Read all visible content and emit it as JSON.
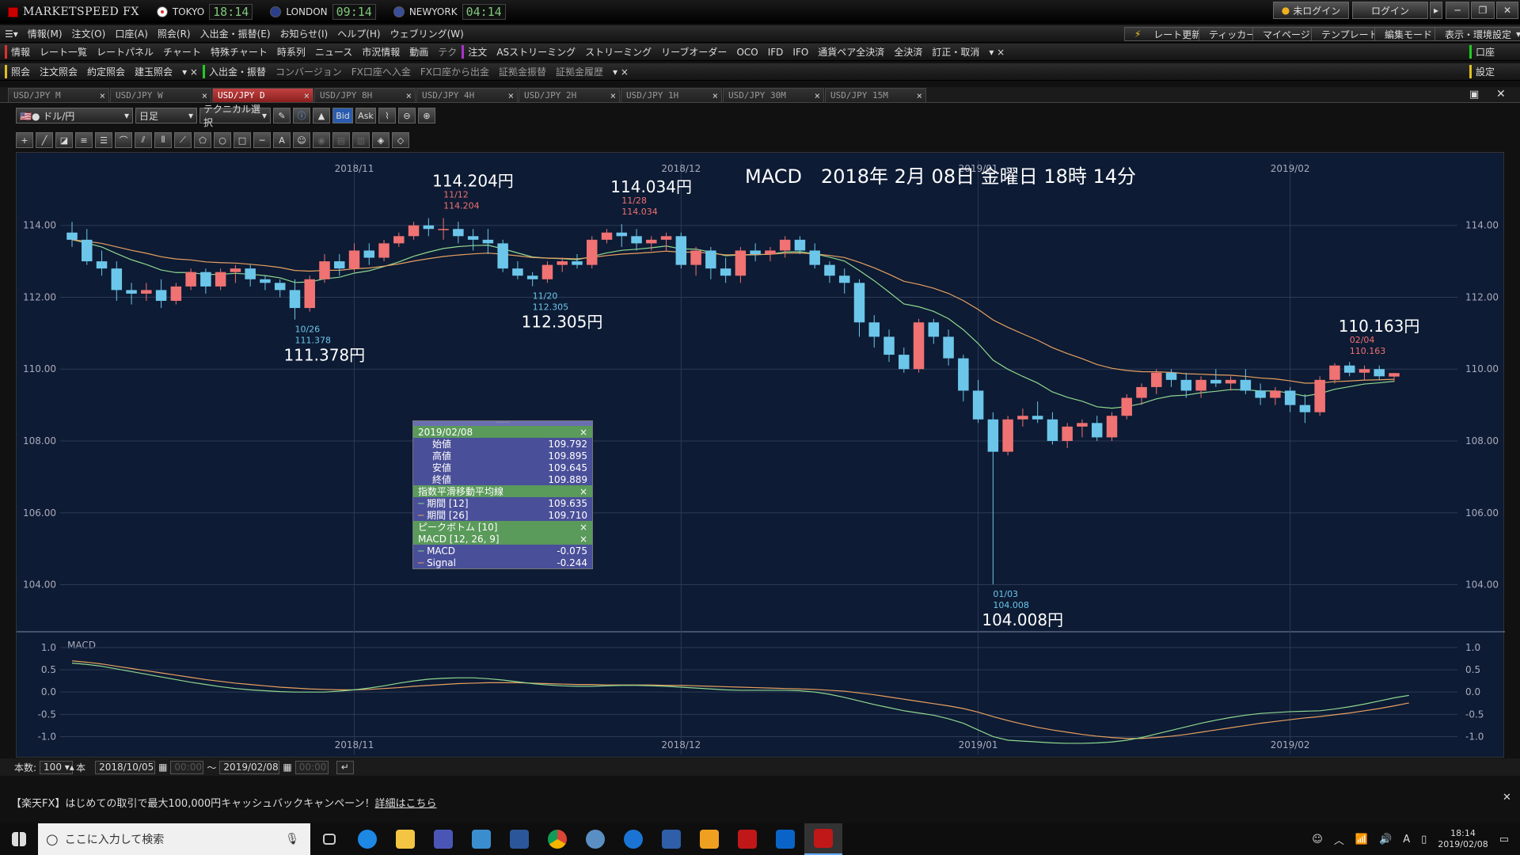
{
  "app": {
    "name": "MARKETSPEED FX",
    "clocks": [
      {
        "label": "TOKYO",
        "time": "18:14",
        "color": "#e03030"
      },
      {
        "label": "LONDON",
        "time": "09:14",
        "color": "#3050c0"
      },
      {
        "label": "NEWYORK",
        "time": "04:14",
        "color": "#3050c0"
      }
    ],
    "login_status": "未ログイン",
    "login_button": "ログイン"
  },
  "menu": {
    "items": [
      "情報(M)",
      "注文(O)",
      "口座(A)",
      "照会(R)",
      "入出金・振替(E)",
      "お知らせ(I)",
      "ヘルプ(H)",
      "ウェブリング(W)"
    ],
    "right": [
      "レート更新",
      "ティッカー",
      "マイページ",
      "テンプレート",
      "編集モード",
      "表示・環境設定"
    ]
  },
  "toolbar1": {
    "group1": "情報",
    "items1": [
      "レート一覧",
      "レートパネル",
      "チャート",
      "特殊チャート",
      "時系列",
      "ニュース",
      "市況情報",
      "動画",
      "テク"
    ],
    "group2": "注文",
    "items2": [
      "ASストリーミング",
      "ストリーミング",
      "リーブオーダー",
      "OCO",
      "IFD",
      "IFO",
      "通貨ペア全決済",
      "全決済",
      "訂正・取消"
    ],
    "right": "口座"
  },
  "toolbar2": {
    "group1": "照会",
    "items1": [
      "注文照会",
      "約定照会",
      "建玉照会"
    ],
    "group2": "入出金・振替",
    "items2": [
      "コンバージョン",
      "FX口座へ入金",
      "FX口座から出金",
      "証拠金振替",
      "証拠金履歴"
    ],
    "right": "設定"
  },
  "tabs": [
    "USD/JPY M",
    "USD/JPY W",
    "USD/JPY D",
    "USD/JPY 8H",
    "USD/JPY 4H",
    "USD/JPY 2H",
    "USD/JPY 1H",
    "USD/JPY 30M",
    "USD/JPY 15M"
  ],
  "active_tab": 2,
  "chart_toolbar": {
    "pair": "ドル/円",
    "period": "日足",
    "technical": "テクニカル選択",
    "bid": "Bid",
    "ask": "Ask"
  },
  "chart_title": "MACD　2018年 2月 08日 金曜日 18時 14分",
  "price_labels": [
    {
      "date": "10/26",
      "price": "111.378",
      "big": "111.378円",
      "type": "low"
    },
    {
      "date": "11/12",
      "price": "114.204",
      "big": "114.204円",
      "type": "high"
    },
    {
      "date": "11/20",
      "price": "112.305",
      "big": "112.305円",
      "type": "low"
    },
    {
      "date": "11/28",
      "price": "114.034",
      "big": "114.034円",
      "type": "high"
    },
    {
      "date": "01/03",
      "price": "104.008",
      "big": "104.008円",
      "type": "low"
    },
    {
      "date": "02/04",
      "price": "110.163",
      "big": "110.163円",
      "type": "high"
    }
  ],
  "chart_data": {
    "type": "candlestick",
    "x_ticks": [
      "2018/11",
      "2018/12",
      "2019/01",
      "2019/02"
    ],
    "y_ticks": [
      "114.00",
      "112.00",
      "110.00",
      "108.00",
      "106.00",
      "104.00"
    ],
    "ylim": [
      102.8,
      115.8
    ],
    "candles": [
      [
        113.8,
        114.1,
        113.4,
        113.6
      ],
      [
        113.6,
        113.9,
        112.9,
        113.0
      ],
      [
        113.0,
        113.3,
        112.6,
        112.8
      ],
      [
        112.8,
        113.0,
        111.9,
        112.2
      ],
      [
        112.2,
        112.4,
        111.8,
        112.1
      ],
      [
        112.1,
        112.4,
        111.9,
        112.2
      ],
      [
        112.2,
        112.5,
        111.7,
        111.9
      ],
      [
        111.9,
        112.4,
        111.8,
        112.3
      ],
      [
        112.3,
        112.8,
        112.2,
        112.7
      ],
      [
        112.7,
        112.8,
        112.1,
        112.3
      ],
      [
        112.3,
        112.8,
        112.2,
        112.7
      ],
      [
        112.7,
        112.9,
        112.4,
        112.8
      ],
      [
        112.8,
        112.9,
        112.3,
        112.5
      ],
      [
        112.5,
        112.6,
        112.2,
        112.4
      ],
      [
        112.4,
        112.5,
        112.0,
        112.2
      ],
      [
        112.2,
        112.5,
        111.378,
        111.7
      ],
      [
        111.7,
        112.6,
        111.6,
        112.5
      ],
      [
        112.5,
        113.2,
        112.4,
        113.0
      ],
      [
        113.0,
        113.2,
        112.6,
        112.8
      ],
      [
        112.8,
        113.5,
        112.7,
        113.3
      ],
      [
        113.3,
        113.5,
        112.9,
        113.1
      ],
      [
        113.1,
        113.6,
        113.0,
        113.5
      ],
      [
        113.5,
        113.8,
        113.4,
        113.7
      ],
      [
        113.7,
        114.1,
        113.6,
        114.0
      ],
      [
        114.0,
        114.2,
        113.7,
        113.9
      ],
      [
        113.9,
        114.204,
        113.6,
        113.9
      ],
      [
        113.9,
        114.1,
        113.5,
        113.7
      ],
      [
        113.7,
        113.9,
        113.3,
        113.6
      ],
      [
        113.6,
        113.9,
        113.2,
        113.5
      ],
      [
        113.5,
        113.6,
        112.7,
        112.8
      ],
      [
        112.8,
        113.0,
        112.5,
        112.6
      ],
      [
        112.6,
        112.7,
        112.305,
        112.5
      ],
      [
        112.5,
        113.0,
        112.4,
        112.9
      ],
      [
        112.9,
        113.1,
        112.7,
        113.0
      ],
      [
        113.0,
        113.2,
        112.8,
        112.9
      ],
      [
        112.9,
        113.7,
        112.8,
        113.6
      ],
      [
        113.6,
        113.9,
        113.5,
        113.8
      ],
      [
        113.8,
        114.034,
        113.4,
        113.7
      ],
      [
        113.7,
        113.9,
        113.3,
        113.5
      ],
      [
        113.5,
        113.7,
        113.3,
        113.6
      ],
      [
        113.6,
        113.8,
        113.3,
        113.7
      ],
      [
        113.7,
        113.8,
        112.8,
        112.9
      ],
      [
        112.9,
        113.4,
        112.6,
        113.3
      ],
      [
        113.3,
        113.4,
        112.5,
        112.8
      ],
      [
        112.8,
        113.1,
        112.4,
        112.6
      ],
      [
        112.6,
        113.4,
        112.4,
        113.3
      ],
      [
        113.3,
        113.5,
        113.0,
        113.2
      ],
      [
        113.2,
        113.4,
        113.0,
        113.3
      ],
      [
        113.3,
        113.7,
        113.1,
        113.6
      ],
      [
        113.6,
        113.7,
        113.2,
        113.3
      ],
      [
        113.3,
        113.5,
        112.8,
        112.9
      ],
      [
        112.9,
        113.0,
        112.4,
        112.6
      ],
      [
        112.6,
        112.8,
        112.1,
        112.4
      ],
      [
        112.4,
        112.5,
        110.9,
        111.3
      ],
      [
        111.3,
        111.5,
        110.6,
        110.9
      ],
      [
        110.9,
        111.1,
        110.2,
        110.4
      ],
      [
        110.4,
        110.6,
        109.9,
        110.0
      ],
      [
        110.0,
        111.4,
        109.9,
        111.3
      ],
      [
        111.3,
        111.4,
        110.7,
        110.9
      ],
      [
        110.9,
        111.1,
        110.1,
        110.3
      ],
      [
        110.3,
        110.4,
        109.1,
        109.4
      ],
      [
        109.4,
        109.7,
        108.5,
        108.6
      ],
      [
        108.6,
        108.8,
        104.008,
        107.7
      ],
      [
        107.7,
        108.7,
        107.6,
        108.6
      ],
      [
        108.6,
        108.9,
        108.4,
        108.7
      ],
      [
        108.7,
        109.1,
        108.5,
        108.6
      ],
      [
        108.6,
        108.8,
        107.9,
        108.0
      ],
      [
        108.0,
        108.5,
        107.8,
        108.4
      ],
      [
        108.4,
        108.6,
        108.1,
        108.5
      ],
      [
        108.5,
        108.7,
        108.0,
        108.1
      ],
      [
        108.1,
        108.8,
        108.0,
        108.7
      ],
      [
        108.7,
        109.3,
        108.6,
        109.2
      ],
      [
        109.2,
        109.6,
        109.0,
        109.5
      ],
      [
        109.5,
        110.0,
        109.3,
        109.9
      ],
      [
        109.9,
        110.0,
        109.5,
        109.7
      ],
      [
        109.7,
        109.9,
        109.2,
        109.4
      ],
      [
        109.4,
        109.8,
        109.2,
        109.7
      ],
      [
        109.7,
        110.0,
        109.5,
        109.6
      ],
      [
        109.6,
        109.8,
        109.4,
        109.7
      ],
      [
        109.7,
        110.0,
        109.3,
        109.4
      ],
      [
        109.4,
        109.6,
        109.0,
        109.2
      ],
      [
        109.2,
        109.5,
        109.0,
        109.4
      ],
      [
        109.4,
        109.5,
        108.8,
        109.0
      ],
      [
        109.0,
        109.3,
        108.5,
        108.8
      ],
      [
        108.8,
        109.8,
        108.7,
        109.7
      ],
      [
        109.7,
        110.163,
        109.6,
        110.1
      ],
      [
        110.1,
        110.2,
        109.8,
        109.9
      ],
      [
        109.9,
        110.1,
        109.7,
        110.0
      ],
      [
        110.0,
        110.1,
        109.7,
        109.8
      ],
      [
        109.792,
        109.895,
        109.645,
        109.889
      ]
    ],
    "macd_ticks": [
      "1.0",
      "0.5",
      "0.0",
      "-0.5",
      "-1.0"
    ],
    "macd_ylim": [
      -1.4,
      1.3
    ],
    "macd": [
      0.65,
      0.62,
      0.58,
      0.52,
      0.46,
      0.4,
      0.34,
      0.28,
      0.22,
      0.17,
      0.12,
      0.08,
      0.05,
      0.03,
      0.01,
      0.0,
      0.0,
      0.0,
      0.02,
      0.05,
      0.09,
      0.14,
      0.2,
      0.25,
      0.29,
      0.31,
      0.32,
      0.32,
      0.3,
      0.27,
      0.23,
      0.19,
      0.16,
      0.14,
      0.13,
      0.13,
      0.14,
      0.15,
      0.15,
      0.14,
      0.13,
      0.11,
      0.09,
      0.07,
      0.05,
      0.04,
      0.04,
      0.04,
      0.04,
      0.03,
      0.0,
      -0.05,
      -0.12,
      -0.2,
      -0.28,
      -0.35,
      -0.42,
      -0.47,
      -0.52,
      -0.6,
      -0.7,
      -0.85,
      -1.0,
      -1.08,
      -1.1,
      -1.12,
      -1.14,
      -1.15,
      -1.15,
      -1.14,
      -1.12,
      -1.08,
      -1.02,
      -0.94,
      -0.86,
      -0.78,
      -0.7,
      -0.63,
      -0.57,
      -0.52,
      -0.48,
      -0.46,
      -0.44,
      -0.43,
      -0.42,
      -0.38,
      -0.33,
      -0.27,
      -0.2,
      -0.13,
      -0.075
    ],
    "signal": [
      0.7,
      0.67,
      0.63,
      0.58,
      0.53,
      0.48,
      0.43,
      0.38,
      0.33,
      0.28,
      0.24,
      0.2,
      0.17,
      0.14,
      0.11,
      0.09,
      0.07,
      0.06,
      0.05,
      0.05,
      0.06,
      0.08,
      0.1,
      0.13,
      0.15,
      0.17,
      0.19,
      0.2,
      0.21,
      0.21,
      0.21,
      0.2,
      0.19,
      0.18,
      0.17,
      0.17,
      0.16,
      0.16,
      0.16,
      0.16,
      0.15,
      0.15,
      0.14,
      0.13,
      0.12,
      0.11,
      0.1,
      0.09,
      0.08,
      0.07,
      0.06,
      0.04,
      0.02,
      -0.02,
      -0.06,
      -0.11,
      -0.16,
      -0.21,
      -0.26,
      -0.31,
      -0.37,
      -0.45,
      -0.55,
      -0.64,
      -0.72,
      -0.79,
      -0.85,
      -0.9,
      -0.95,
      -0.99,
      -1.02,
      -1.04,
      -1.04,
      -1.02,
      -0.99,
      -0.95,
      -0.9,
      -0.85,
      -0.8,
      -0.75,
      -0.7,
      -0.66,
      -0.62,
      -0.58,
      -0.55,
      -0.51,
      -0.47,
      -0.42,
      -0.37,
      -0.31,
      -0.244
    ],
    "macd_label": "MACD"
  },
  "popup": {
    "date": "2019/02/08",
    "rows": [
      {
        "k": "始値",
        "v": "109.792"
      },
      {
        "k": "高値",
        "v": "109.895"
      },
      {
        "k": "安値",
        "v": "109.645"
      },
      {
        "k": "終値",
        "v": "109.889"
      }
    ],
    "ema_title": "指数平滑移動平均線",
    "ema": [
      {
        "k": "期間 [12]",
        "v": "109.635",
        "c": "#8fd88f"
      },
      {
        "k": "期間 [26]",
        "v": "109.710",
        "c": "#e8a060"
      }
    ],
    "peak": "ピークボトム [10]",
    "macd_title": "MACD [12, 26, 9]",
    "macd": [
      {
        "k": "MACD",
        "v": "-0.075",
        "c": "#8fd88f"
      },
      {
        "k": "Signal",
        "v": "-0.244",
        "c": "#e8a060"
      }
    ]
  },
  "status": {
    "count_label": "本数:",
    "count": "100",
    "unit": "本",
    "from": "2018/10/05",
    "from_time": "00:00",
    "to": "2019/02/08",
    "to_time": "00:00"
  },
  "banner": {
    "text": "【楽天FX】はじめての取引で最大100,000円キャッシュバックキャンペーン！",
    "link": "詳細はこちら"
  },
  "taskbar": {
    "search": "ここに入力して検索",
    "time": "18:14",
    "date": "2019/02/08"
  },
  "colors": {
    "up": "#f07272",
    "down": "#6cc6ea",
    "ema12": "#8fd88f",
    "ema26": "#e8a060",
    "bg": "#0d1b34"
  }
}
